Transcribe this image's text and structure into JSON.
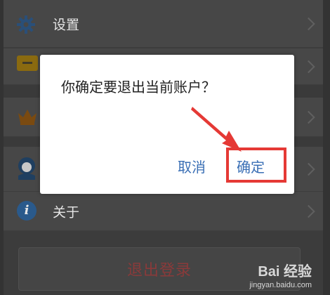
{
  "settings_list": {
    "settings_label": "设置",
    "about_label": "关于"
  },
  "dialog": {
    "message": "你确定要退出当前账户？",
    "cancel_label": "取消",
    "confirm_label": "确定"
  },
  "logout": {
    "label": "退出登录"
  },
  "watermark": {
    "logo_text": "Bai 经验",
    "url": "jingyan.baidu.com"
  },
  "colors": {
    "accent_blue": "#3a6fb5",
    "highlight_red": "#e53935",
    "logout_red": "#8a3a3a"
  }
}
